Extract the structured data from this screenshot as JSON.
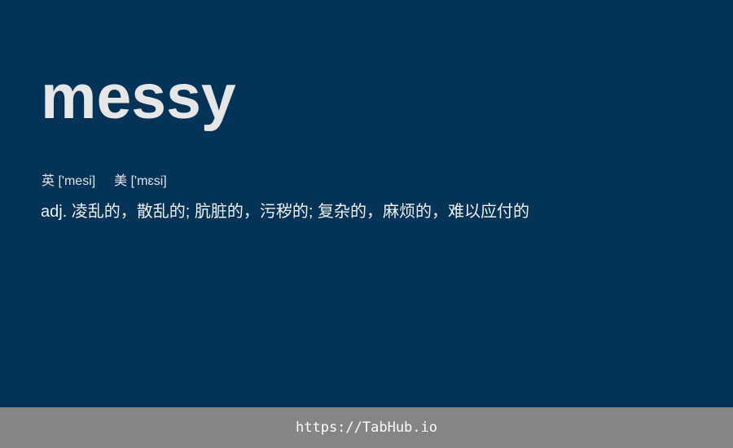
{
  "word": "messy",
  "phonetics": {
    "uk_label": "英",
    "uk": "['mesi]",
    "us_label": "美",
    "us": "['mɛsi]"
  },
  "definition": "adj. 凌乱的，散乱的; 肮脏的，污秽的; 复杂的，麻烦的，难以应付的",
  "footer": {
    "url": "https://TabHub.io"
  },
  "colors": {
    "background": "#033457",
    "footer_background": "#858585",
    "word_text": "#e6e6e6"
  }
}
